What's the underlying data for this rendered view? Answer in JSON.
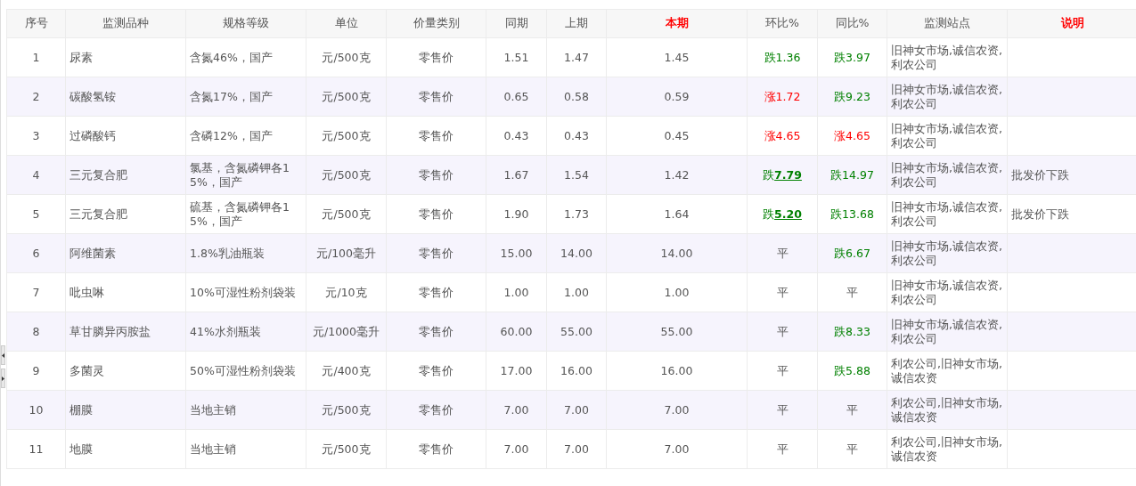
{
  "table": {
    "columns": [
      {
        "label": "序号",
        "highlighted": false
      },
      {
        "label": "监测品种",
        "highlighted": false
      },
      {
        "label": "规格等级",
        "highlighted": false
      },
      {
        "label": "单位",
        "highlighted": false
      },
      {
        "label": "价量类别",
        "highlighted": false
      },
      {
        "label": "同期",
        "highlighted": false
      },
      {
        "label": "上期",
        "highlighted": false
      },
      {
        "label": "本期",
        "highlighted": true
      },
      {
        "label": "环比%",
        "highlighted": false
      },
      {
        "label": "同比%",
        "highlighted": false
      },
      {
        "label": "监测站点",
        "highlighted": false
      },
      {
        "label": "说明",
        "highlighted": true
      }
    ],
    "rows": [
      {
        "no": "1",
        "name": "尿素",
        "spec": "含氮46%，国产",
        "unit": "元/500克",
        "type": "零售价",
        "same": "1.51",
        "prev": "1.47",
        "cur": "1.45",
        "mom": {
          "kind": "down",
          "text": "跌",
          "value": "1.36",
          "emphasized": false
        },
        "yoy": {
          "kind": "down",
          "text": "跌",
          "value": "3.97",
          "emphasized": false
        },
        "stations": "旧神女市场,诚信农资,利农公司"
      },
      {
        "no": "2",
        "name": "碳酸氢铵",
        "spec": "含氮17%，国产",
        "unit": "元/500克",
        "type": "零售价",
        "same": "0.65",
        "prev": "0.58",
        "cur": "0.59",
        "mom": {
          "kind": "up",
          "text": "涨",
          "value": "1.72",
          "emphasized": false
        },
        "yoy": {
          "kind": "down",
          "text": "跌",
          "value": "9.23",
          "emphasized": false
        },
        "stations": "旧神女市场,诚信农资,利农公司"
      },
      {
        "no": "3",
        "name": "过磷酸钙",
        "spec": "含磷12%，国产",
        "unit": "元/500克",
        "type": "零售价",
        "same": "0.43",
        "prev": "0.43",
        "cur": "0.45",
        "mom": {
          "kind": "up",
          "text": "涨",
          "value": "4.65",
          "emphasized": false
        },
        "yoy": {
          "kind": "up",
          "text": "涨",
          "value": "4.65",
          "emphasized": false
        },
        "stations": "旧神女市场,诚信农资,利农公司"
      },
      {
        "no": "4",
        "name": "三元复合肥",
        "spec": "氯基，含氮磷钾各15%，国产",
        "unit": "元/500克",
        "type": "零售价",
        "same": "1.67",
        "prev": "1.54",
        "cur": "1.42",
        "mom": {
          "kind": "down",
          "text": "跌",
          "value": "7.79",
          "emphasized": true
        },
        "yoy": {
          "kind": "down",
          "text": "跌",
          "value": "14.97",
          "emphasized": false
        },
        "stations": "旧神女市场,诚信农资,利农公司",
        "note": "批发价下跌"
      },
      {
        "no": "5",
        "name": "三元复合肥",
        "spec": "硫基，含氮磷钾各15%，国产",
        "unit": "元/500克",
        "type": "零售价",
        "same": "1.90",
        "prev": "1.73",
        "cur": "1.64",
        "mom": {
          "kind": "down",
          "text": "跌",
          "value": "5.20",
          "emphasized": true
        },
        "yoy": {
          "kind": "down",
          "text": "跌",
          "value": "13.68",
          "emphasized": false
        },
        "stations": "旧神女市场,诚信农资,利农公司",
        "note": "批发价下跌"
      },
      {
        "no": "6",
        "name": "阿维菌素",
        "spec": "1.8%乳油瓶装",
        "unit": "元/100毫升",
        "type": "零售价",
        "same": "15.00",
        "prev": "14.00",
        "cur": "14.00",
        "mom": {
          "kind": "flat",
          "text": "平"
        },
        "yoy": {
          "kind": "down",
          "text": "跌",
          "value": "6.67",
          "emphasized": false
        },
        "stations": "旧神女市场,诚信农资,利农公司"
      },
      {
        "no": "7",
        "name": "吡虫啉",
        "spec": "10%可湿性粉剂袋装",
        "unit": "元/10克",
        "type": "零售价",
        "same": "1.00",
        "prev": "1.00",
        "cur": "1.00",
        "mom": {
          "kind": "flat",
          "text": "平"
        },
        "yoy": {
          "kind": "flat",
          "text": "平"
        },
        "stations": "旧神女市场,诚信农资,利农公司"
      },
      {
        "no": "8",
        "name": "草甘膦异丙胺盐",
        "spec": "41%水剂瓶装",
        "unit": "元/1000毫升",
        "type": "零售价",
        "same": "60.00",
        "prev": "55.00",
        "cur": "55.00",
        "mom": {
          "kind": "flat",
          "text": "平"
        },
        "yoy": {
          "kind": "down",
          "text": "跌",
          "value": "8.33",
          "emphasized": false
        },
        "stations": "旧神女市场,诚信农资,利农公司"
      },
      {
        "no": "9",
        "name": "多菌灵",
        "spec": "50%可湿性粉剂袋装",
        "unit": "元/400克",
        "type": "零售价",
        "same": "17.00",
        "prev": "16.00",
        "cur": "16.00",
        "mom": {
          "kind": "flat",
          "text": "平"
        },
        "yoy": {
          "kind": "down",
          "text": "跌",
          "value": "5.88",
          "emphasized": false
        },
        "stations": "利农公司,旧神女市场,诚信农资"
      },
      {
        "no": "10",
        "name": "棚膜",
        "spec": "当地主销",
        "unit": "元/500克",
        "type": "零售价",
        "same": "7.00",
        "prev": "7.00",
        "cur": "7.00",
        "mom": {
          "kind": "flat",
          "text": "平"
        },
        "yoy": {
          "kind": "flat",
          "text": "平"
        },
        "stations": "利农公司,旧神女市场,诚信农资"
      },
      {
        "no": "11",
        "name": "地膜",
        "spec": "当地主销",
        "unit": "元/500克",
        "type": "零售价",
        "same": "7.00",
        "prev": "7.00",
        "cur": "7.00",
        "mom": {
          "kind": "flat",
          "text": "平"
        },
        "yoy": {
          "kind": "flat",
          "text": "平"
        },
        "stations": "利农公司,旧神女市场,诚信农资"
      }
    ]
  }
}
